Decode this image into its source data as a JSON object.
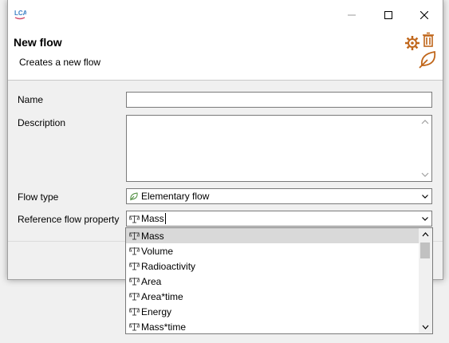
{
  "window": {
    "controls": {
      "minimize_icon": "minimize-icon",
      "maximize_icon": "maximize-icon",
      "close_icon": "close-icon"
    }
  },
  "header": {
    "title": "New flow",
    "message": "Creates a new flow"
  },
  "form": {
    "name_label": "Name",
    "name_value": "",
    "description_label": "Description",
    "description_value": "",
    "flow_type_label": "Flow type",
    "flow_type_value": "Elementary flow",
    "ref_prop_label": "Reference flow property",
    "ref_prop_value": "Mass"
  },
  "dropdown": {
    "items": [
      "Mass",
      "Volume",
      "Radioactivity",
      "Area",
      "Area*time",
      "Energy",
      "Mass*time"
    ],
    "selected": "Mass"
  },
  "colors": {
    "accent_orange": "#c0661a",
    "leaf_green": "#4a8a3a",
    "logo_blue": "#3a7fc4"
  }
}
